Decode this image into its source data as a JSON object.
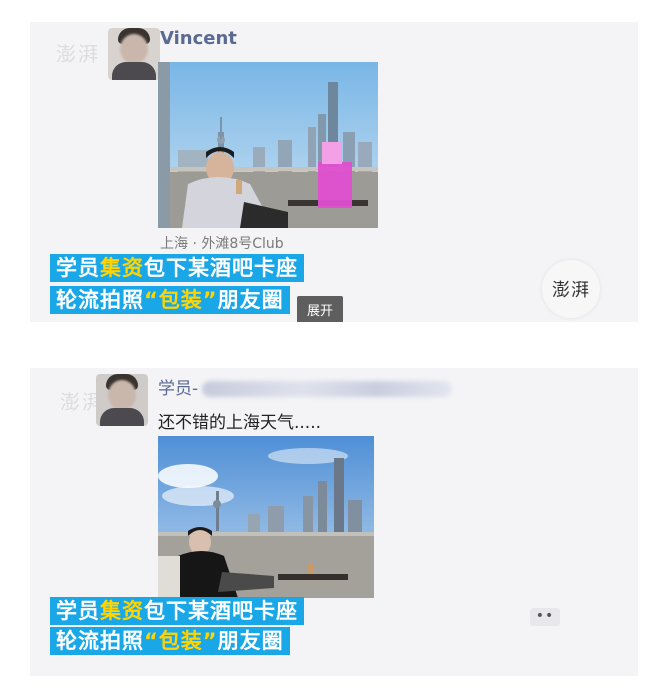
{
  "post1": {
    "author": "Vincent",
    "location": "上海 · 外滩8号Club",
    "expand_label": "展开",
    "watermark": "澎湃",
    "caption_line1": {
      "pre": "学员",
      "highlight": "集资",
      "post": "包下某酒吧卡座"
    },
    "caption_line2": {
      "pre": "轮流拍照",
      "highlight": "“包装”",
      "post": "朋友圈"
    }
  },
  "post2": {
    "author_prefix": "学员-",
    "text": "还不错的上海天气.....",
    "more_icon": "more-dots-icon",
    "caption_line1": {
      "pre": "学员",
      "highlight": "集资",
      "post": "包下某酒吧卡座"
    },
    "caption_line2": {
      "pre": "轮流拍照",
      "highlight": "“包装”",
      "post": "朋友圈"
    }
  },
  "colors": {
    "banner": "#1aa7e8",
    "highlight": "#ffd400",
    "name": "#5a6a92"
  }
}
